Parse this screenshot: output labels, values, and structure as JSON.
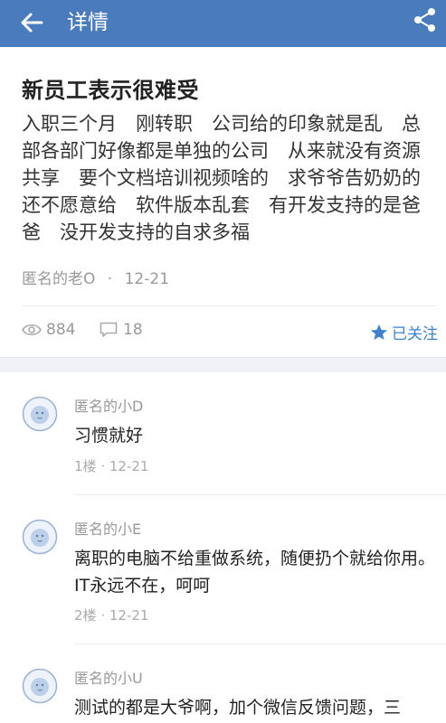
{
  "header": {
    "title": "详情",
    "back_icon": "back-arrow-icon",
    "share_icon": "share-icon",
    "color": "#4a7bbd"
  },
  "post": {
    "title": "新员工表示很难受",
    "body": "入职三个月　刚转职　公司给的印象就是乱　总部各部门好像都是单独的公司　从来就没有资源共享　要个文档培训视频啥的　求爷爷告奶奶的　还不愿意给　软件版本乱套　有开发支持的是爸爸　没开发支持的自求多福",
    "author": "匿名的老O",
    "date": "12-21",
    "views": "884",
    "comments": "18",
    "follow_label": "已关注",
    "accent": "#3f80cf"
  },
  "comments": [
    {
      "author": "匿名的小D",
      "text": "习惯就好",
      "floor": "1楼",
      "date": "12-21"
    },
    {
      "author": "匿名的小E",
      "text": "离职的电脑不给重做系统，随便扔个就给你用。IT永远不在，呵呵",
      "floor": "2楼",
      "date": "12-21"
    },
    {
      "author": "匿名的小U",
      "text": "测试的都是大爷啊，加个微信反馈问题，三",
      "floor": "",
      "date": ""
    }
  ]
}
